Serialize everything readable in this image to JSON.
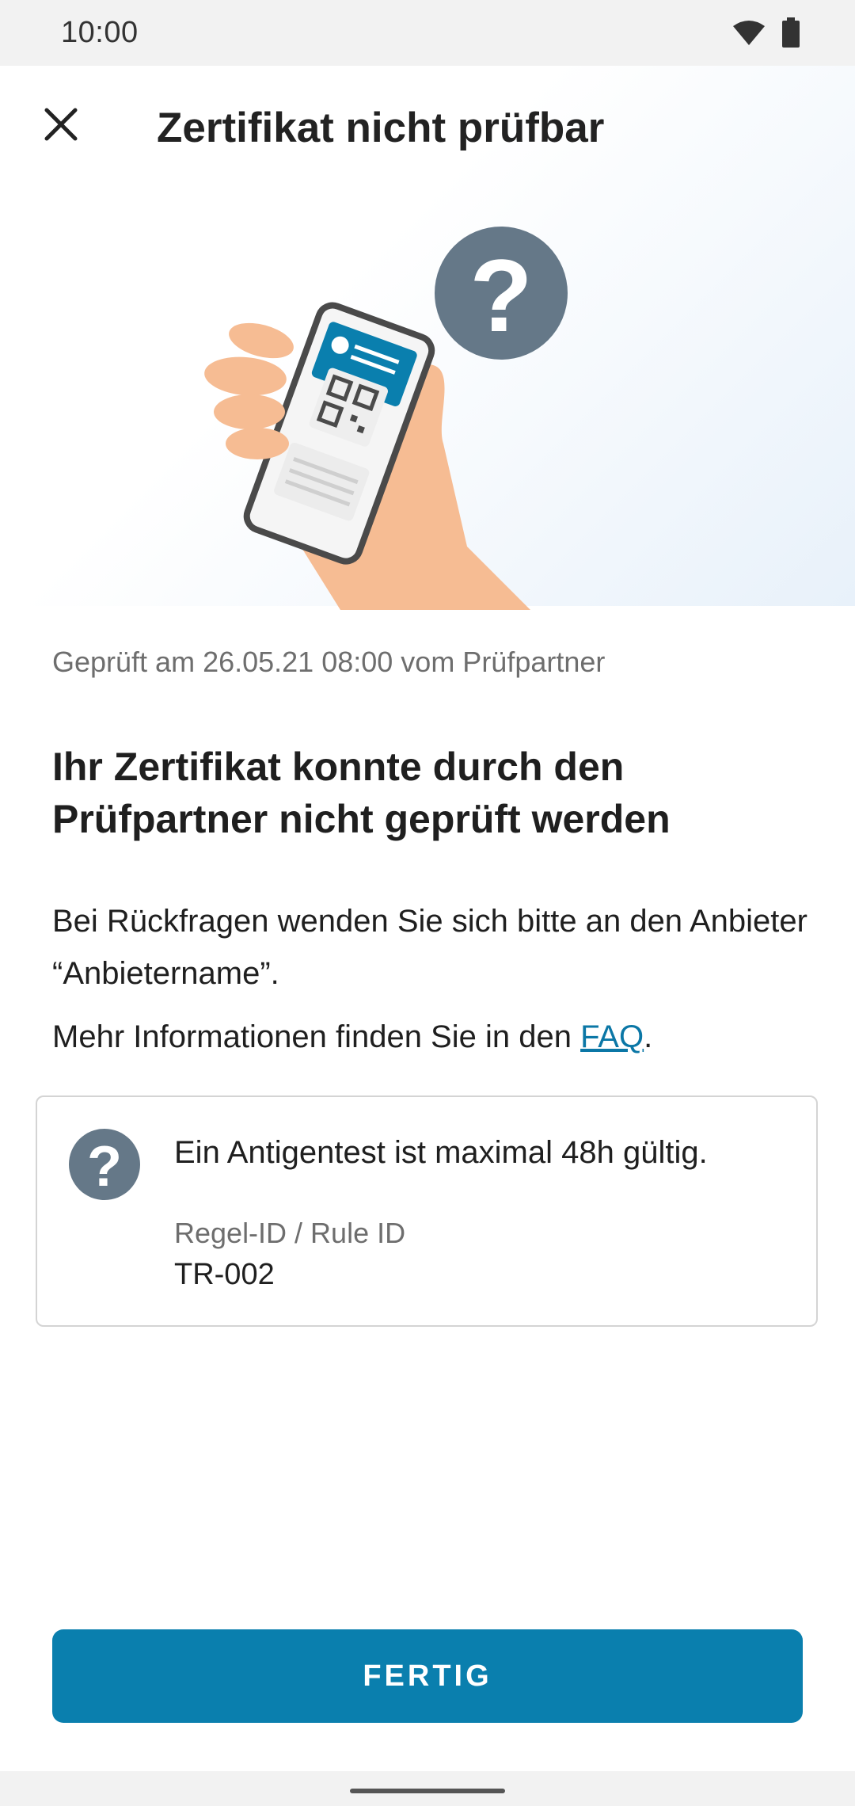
{
  "status": {
    "time": "10:00",
    "icons": [
      "wifi-icon",
      "battery-icon"
    ]
  },
  "header": {
    "title": "Zertifikat nicht prüfbar",
    "close_icon": "close-icon"
  },
  "result": {
    "checked_meta": "Geprüft am 26.05.21 08:00 vom Prüfpartner",
    "headline": "Ihr Zertifikat konnte durch den Prüfpartner nicht geprüft werden",
    "contact_text": "Bei Rückfragen wenden Sie sich bitte an den Anbieter “Anbietername”.",
    "more_info_prefix": "Mehr Informationen finden Sie in den ",
    "faq_link": "FAQ",
    "more_info_suffix": "."
  },
  "rule": {
    "icon": "question-icon",
    "text": "Ein Antigentest ist maximal 48h gültig.",
    "id_label": "Regel-ID / Rule ID",
    "id_value": "TR-002"
  },
  "footer": {
    "done_label": "FERTIG"
  },
  "colors": {
    "accent": "#0a7fae",
    "question_badge": "#657888",
    "skin": "#f6bc93"
  }
}
